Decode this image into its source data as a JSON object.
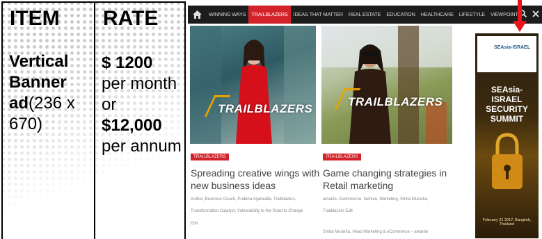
{
  "table": {
    "header_item": "ITEM",
    "header_rate": "RATE",
    "item": {
      "name_line1": "Vertical",
      "name_line2": "Banner",
      "name_line3": "ad",
      "size": "(236 x 670)"
    },
    "rate": {
      "monthly_price": "$ 1200",
      "monthly_suffix": "per month or",
      "annual_price": "$12,000",
      "annual_suffix": "per annum"
    }
  },
  "site": {
    "nav": {
      "items": [
        "WINNING WAYS",
        "TRAILBLAZERS",
        "IDEAS THAT MATTER",
        "REAL ESTATE",
        "EDUCATION",
        "HEALTHCARE",
        "LIFESTYLE",
        "VIEWPOINT"
      ],
      "active_index": 1,
      "icons": [
        "home-icon",
        "search-icon",
        "close-icon"
      ]
    },
    "cards": [
      {
        "image_stamp": "TRAILBLAZERS",
        "tag": "TRAILBLAZERS",
        "title": "Spreading creative wings with new business ideas",
        "meta_1": "Author, Business Coach, Prabina Agarwalla, Trailblazers,",
        "meta_2": "Transformation Catalyst, Vulnerability to the Road to Change",
        "meta_3": "Edit"
      },
      {
        "image_stamp": "TRAILBLAZERS",
        "tag": "TRAILBLAZERS",
        "title": "Game changing strategies in Retail marketing",
        "meta_1": "amante, Ecommerce, fashion, Marketing, Smita Murarka,",
        "meta_2": "Trailblazers  Edit",
        "meta_3": "Smita Murarka, Head Marketing & eCommerce – amante"
      }
    ],
    "banner": {
      "logo_text": "SEAsia-ISRAEL",
      "title": "SEAsia-ISRAEL SECURITY SUMMIT",
      "date": "February 21 2017, Bangkok, Thailand"
    }
  },
  "colors": {
    "nav_bg": "#1c1c1c",
    "accent_red": "#d2232a",
    "arrow_red": "#e8141c"
  }
}
